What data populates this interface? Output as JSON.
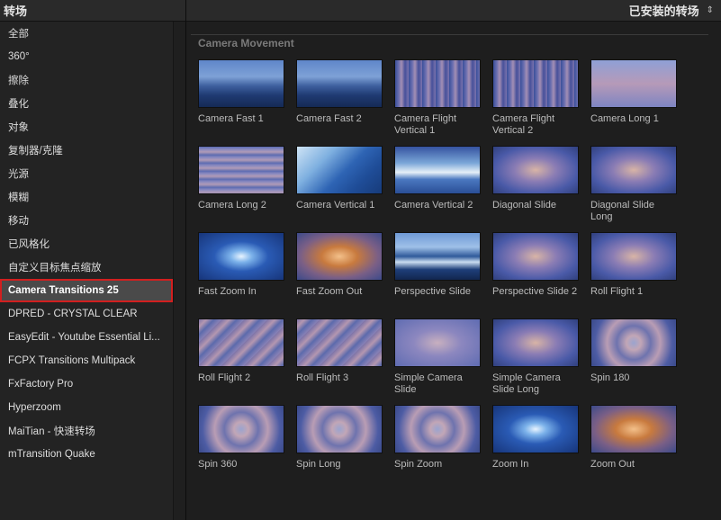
{
  "sidebar": {
    "title": "转场",
    "items": [
      {
        "label": "全部"
      },
      {
        "label": "360°"
      },
      {
        "label": "擦除"
      },
      {
        "label": "叠化"
      },
      {
        "label": "对象"
      },
      {
        "label": "复制器/克隆"
      },
      {
        "label": "光源"
      },
      {
        "label": "模糊"
      },
      {
        "label": "移动"
      },
      {
        "label": "已风格化"
      },
      {
        "label": "自定义目标焦点缩放"
      },
      {
        "label": "Camera Transitions 25",
        "selected": true
      },
      {
        "label": "DPRED - CRYSTAL CLEAR"
      },
      {
        "label": "EasyEdit - Youtube Essential Li..."
      },
      {
        "label": "FCPX Transitions Multipack"
      },
      {
        "label": "FxFactory Pro"
      },
      {
        "label": "Hyperzoom"
      },
      {
        "label": "MaiTian - 快速转场"
      },
      {
        "label": "mTransition Quake"
      }
    ]
  },
  "header": {
    "filter_label": "已安装的转场",
    "chevron_icon": "updown-chevron-icon"
  },
  "section": {
    "title": "Camera Movement"
  },
  "tiles": [
    {
      "label": "Camera Fast 1",
      "style": "mountain"
    },
    {
      "label": "Camera Fast 2",
      "style": "mountain"
    },
    {
      "label": "Camera Flight Vertical 1",
      "style": "vblur"
    },
    {
      "label": "Camera Flight Vertical 2",
      "style": "vblur"
    },
    {
      "label": "Camera Long 1",
      "style": "longsoft"
    },
    {
      "label": "Camera Long 2",
      "style": "hblur"
    },
    {
      "label": "Camera Vertical 1",
      "style": "vertical"
    },
    {
      "label": "Camera Vertical 2",
      "style": "horizon"
    },
    {
      "label": "Diagonal Slide",
      "style": "zoomcool"
    },
    {
      "label": "Diagonal Slide Long",
      "style": "zoomcool"
    },
    {
      "label": "Fast Zoom In",
      "style": "blueburst"
    },
    {
      "label": "Fast Zoom Out",
      "style": "orangeburst"
    },
    {
      "label": "Perspective Slide",
      "style": "mountain2"
    },
    {
      "label": "Perspective Slide 2",
      "style": "zoomcool"
    },
    {
      "label": "Roll Flight 1",
      "style": "zoomcool"
    },
    {
      "label": "Roll Flight 2",
      "style": "diag"
    },
    {
      "label": "Roll Flight 3",
      "style": "diag"
    },
    {
      "label": "Simple Camera Slide",
      "style": "soft"
    },
    {
      "label": "Simple Camera Slide Long",
      "style": "zoomcool"
    },
    {
      "label": "Spin 180",
      "style": "spin"
    },
    {
      "label": "Spin 360",
      "style": "spin"
    },
    {
      "label": "Spin Long",
      "style": "spin"
    },
    {
      "label": "Spin Zoom",
      "style": "spin"
    },
    {
      "label": "Zoom In",
      "style": "blueburst"
    },
    {
      "label": "Zoom Out",
      "style": "orangeburst"
    }
  ],
  "colors": {
    "selection_border": "#d21f1f",
    "selection_bg": "#4a4a4a",
    "background": "#1e1e1e"
  }
}
